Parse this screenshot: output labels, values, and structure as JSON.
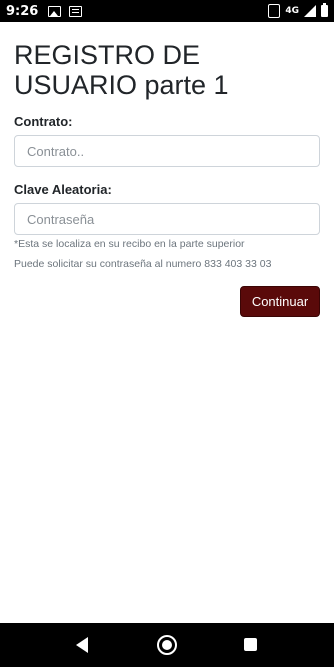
{
  "status_bar": {
    "time": "9:26",
    "network": "4G",
    "icons": [
      "image-icon",
      "message-icon",
      "vibrate-icon",
      "signal-icon",
      "battery-icon"
    ]
  },
  "form": {
    "title": "REGISTRO DE USUARIO parte 1",
    "contract": {
      "label": "Contrato:",
      "placeholder": "Contrato..",
      "value": ""
    },
    "clave": {
      "label": "Clave Aleatoria:",
      "placeholder": "Contraseña",
      "value": ""
    },
    "help_line1": "*Esta se localiza en su recibo en la parte superior",
    "help_line2": "Puede solicitar su contraseña al numero 833 403 33 03",
    "submit_label": "Continuar"
  },
  "colors": {
    "button_bg": "#5a0a0a",
    "background": "#ffffff"
  },
  "nav_bar": {
    "buttons": [
      "back-icon",
      "home-icon",
      "recents-icon"
    ]
  }
}
